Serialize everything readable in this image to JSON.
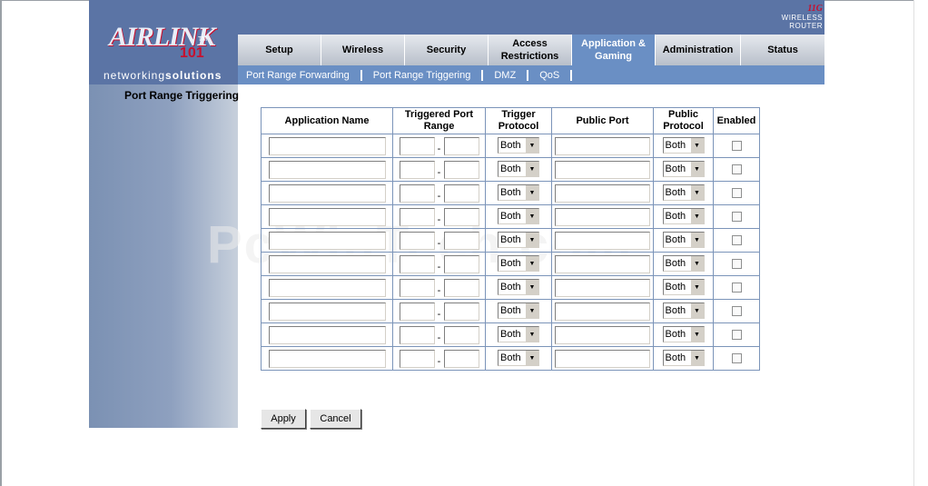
{
  "brand": {
    "logo_text": "AIRLINK",
    "logo_number": "101",
    "logo_tm": "TM",
    "tagline_part1": "networking",
    "tagline_part2": "solutions",
    "badge_11g": "11G",
    "badge_text": "WIRELESS ROUTER"
  },
  "tabs": [
    {
      "label": "Setup",
      "active": false
    },
    {
      "label": "Wireless",
      "active": false
    },
    {
      "label": "Security",
      "active": false
    },
    {
      "label": "Access Restrictions",
      "active": false
    },
    {
      "label": "Application & Gaming",
      "active": true
    },
    {
      "label": "Administration",
      "active": false
    },
    {
      "label": "Status",
      "active": false
    }
  ],
  "subnav": [
    {
      "label": "Port Range Forwarding"
    },
    {
      "label": "Port Range Triggering"
    },
    {
      "label": "DMZ"
    },
    {
      "label": "QoS"
    }
  ],
  "section_title": "Port Range Triggering",
  "table": {
    "headers": {
      "app_name": "Application Name",
      "triggered_range": "Triggered Port Range",
      "trigger_protocol": "Trigger Protocol",
      "public_port": "Public Port",
      "public_protocol": "Public Protocol",
      "enabled": "Enabled"
    },
    "rows": [
      {
        "app": "",
        "trig_start": "",
        "trig_end": "",
        "trig_proto": "Both",
        "public_port": "",
        "pub_proto": "Both",
        "enabled": false
      },
      {
        "app": "",
        "trig_start": "",
        "trig_end": "",
        "trig_proto": "Both",
        "public_port": "",
        "pub_proto": "Both",
        "enabled": false
      },
      {
        "app": "",
        "trig_start": "",
        "trig_end": "",
        "trig_proto": "Both",
        "public_port": "",
        "pub_proto": "Both",
        "enabled": false
      },
      {
        "app": "",
        "trig_start": "",
        "trig_end": "",
        "trig_proto": "Both",
        "public_port": "",
        "pub_proto": "Both",
        "enabled": false
      },
      {
        "app": "",
        "trig_start": "",
        "trig_end": "",
        "trig_proto": "Both",
        "public_port": "",
        "pub_proto": "Both",
        "enabled": false
      },
      {
        "app": "",
        "trig_start": "",
        "trig_end": "",
        "trig_proto": "Both",
        "public_port": "",
        "pub_proto": "Both",
        "enabled": false
      },
      {
        "app": "",
        "trig_start": "",
        "trig_end": "",
        "trig_proto": "Both",
        "public_port": "",
        "pub_proto": "Both",
        "enabled": false
      },
      {
        "app": "",
        "trig_start": "",
        "trig_end": "",
        "trig_proto": "Both",
        "public_port": "",
        "pub_proto": "Both",
        "enabled": false
      },
      {
        "app": "",
        "trig_start": "",
        "trig_end": "",
        "trig_proto": "Both",
        "public_port": "",
        "pub_proto": "Both",
        "enabled": false
      },
      {
        "app": "",
        "trig_start": "",
        "trig_end": "",
        "trig_proto": "Both",
        "public_port": "",
        "pub_proto": "Both",
        "enabled": false
      }
    ],
    "range_separator": "-"
  },
  "buttons": {
    "apply": "Apply",
    "cancel": "Cancel"
  },
  "watermark": "PcWinTech.com",
  "colors": {
    "header_bg": "#5b74a5",
    "active_tab": "#6a8fc4",
    "table_border": "#7b94b9",
    "brand_red": "#c8102e"
  }
}
